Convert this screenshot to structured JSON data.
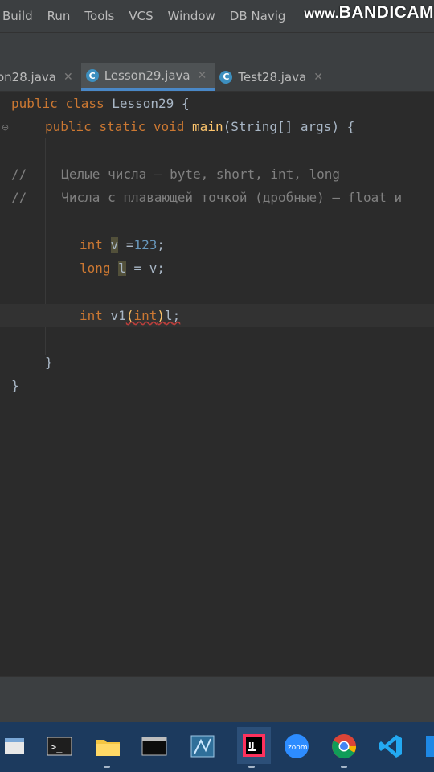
{
  "menu": [
    "Build",
    "Run",
    "Tools",
    "VCS",
    "Window",
    "DB Navig"
  ],
  "watermark": {
    "prefix": "www.",
    "brand": "BANDICAM"
  },
  "tabs": [
    {
      "label": "on28.java",
      "active": false
    },
    {
      "label": "Lesson29.java",
      "active": true
    },
    {
      "label": "Test28.java",
      "active": false
    }
  ],
  "code": {
    "l1": {
      "kw1": "public",
      "kw2": "class",
      "name": "Lesson29",
      "brace": "{"
    },
    "l2": {
      "kw1": "public",
      "kw2": "static",
      "kw3": "void",
      "fn": "main",
      "rest": "(String[] args) {"
    },
    "l4": {
      "slash": "//",
      "text": "Целые числа — byte, short, int, long"
    },
    "l5": {
      "slash": "//",
      "text": "Числа с плавающей точкой (дробные) — float и"
    },
    "l7": {
      "kw": "int",
      "var": "v",
      "eq": " =",
      "num": "123",
      "end": ";"
    },
    "l8": {
      "kw": "long",
      "var": "l",
      "rest": " = v;"
    },
    "l10": {
      "kw": "int",
      "var": "v1",
      "paren1": "(",
      "cast": "int",
      "paren2": ")",
      "var2": "l",
      "end": ";"
    },
    "l12": {
      "brace": "}"
    },
    "l13": {
      "brace": "}"
    }
  },
  "icons": {
    "tab_file": "java-class-icon",
    "gutter_error": "error-bulb-icon"
  },
  "taskbar": [
    "file-explorer-icon",
    "terminal-icon",
    "folder-icon",
    "cmd-icon",
    "network-icon",
    "intellij-icon",
    "zoom-icon",
    "chrome-icon",
    "vscode-icon"
  ],
  "taskbar_zoom_label": "zoom"
}
